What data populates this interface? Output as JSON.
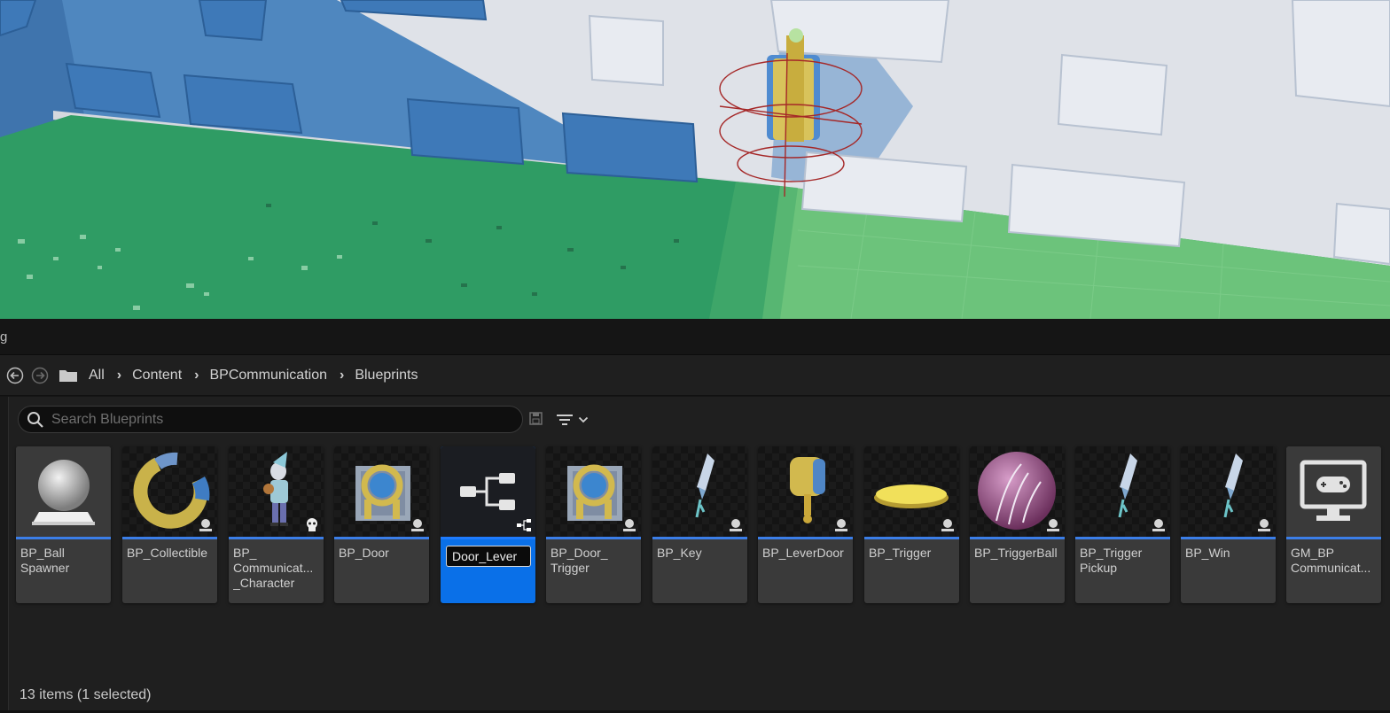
{
  "tab": {
    "title_fragment": "g"
  },
  "path": {
    "crumbs": [
      "All",
      "Content",
      "BPCommunication",
      "Blueprints"
    ]
  },
  "search": {
    "placeholder": "Search Blueprints",
    "value": ""
  },
  "assets": [
    {
      "label": "BP_Ball\nSpawner",
      "thumb": "sphere-spawner",
      "badge": "blueprint-badge"
    },
    {
      "label": "BP_Collectible",
      "thumb": "ring-collectible",
      "badge": "blueprint-badge"
    },
    {
      "label": "BP_\nCommunicat...\n_Character",
      "thumb": "character",
      "badge": "skeleton-badge"
    },
    {
      "label": "BP_Door",
      "thumb": "door",
      "badge": "blueprint-badge"
    },
    {
      "label": "",
      "thumb": "blueprint-graph",
      "badge": "graph-badge",
      "rename_value": "Door_Lever",
      "selected": true
    },
    {
      "label": "BP_Door_\nTrigger",
      "thumb": "door",
      "badge": "blueprint-badge"
    },
    {
      "label": "BP_Key",
      "thumb": "key",
      "badge": "blueprint-badge"
    },
    {
      "label": "BP_LeverDoor",
      "thumb": "lever",
      "badge": "blueprint-badge"
    },
    {
      "label": "BP_Trigger",
      "thumb": "trigger-pad",
      "badge": "blueprint-badge"
    },
    {
      "label": "BP_TriggerBall",
      "thumb": "trigger-ball",
      "badge": "blueprint-badge"
    },
    {
      "label": "BP_Trigger\nPickup",
      "thumb": "key",
      "badge": "blueprint-badge"
    },
    {
      "label": "BP_Win",
      "thumb": "key",
      "badge": "blueprint-badge"
    },
    {
      "label": "GM_BP\nCommunicat...",
      "thumb": "game-mode",
      "badge": ""
    }
  ],
  "status": {
    "text": "13 items (1 selected)"
  },
  "colors": {
    "accent": "#3b7ee8",
    "selected": "#0a70e8",
    "panel": "#1f1f1f"
  }
}
